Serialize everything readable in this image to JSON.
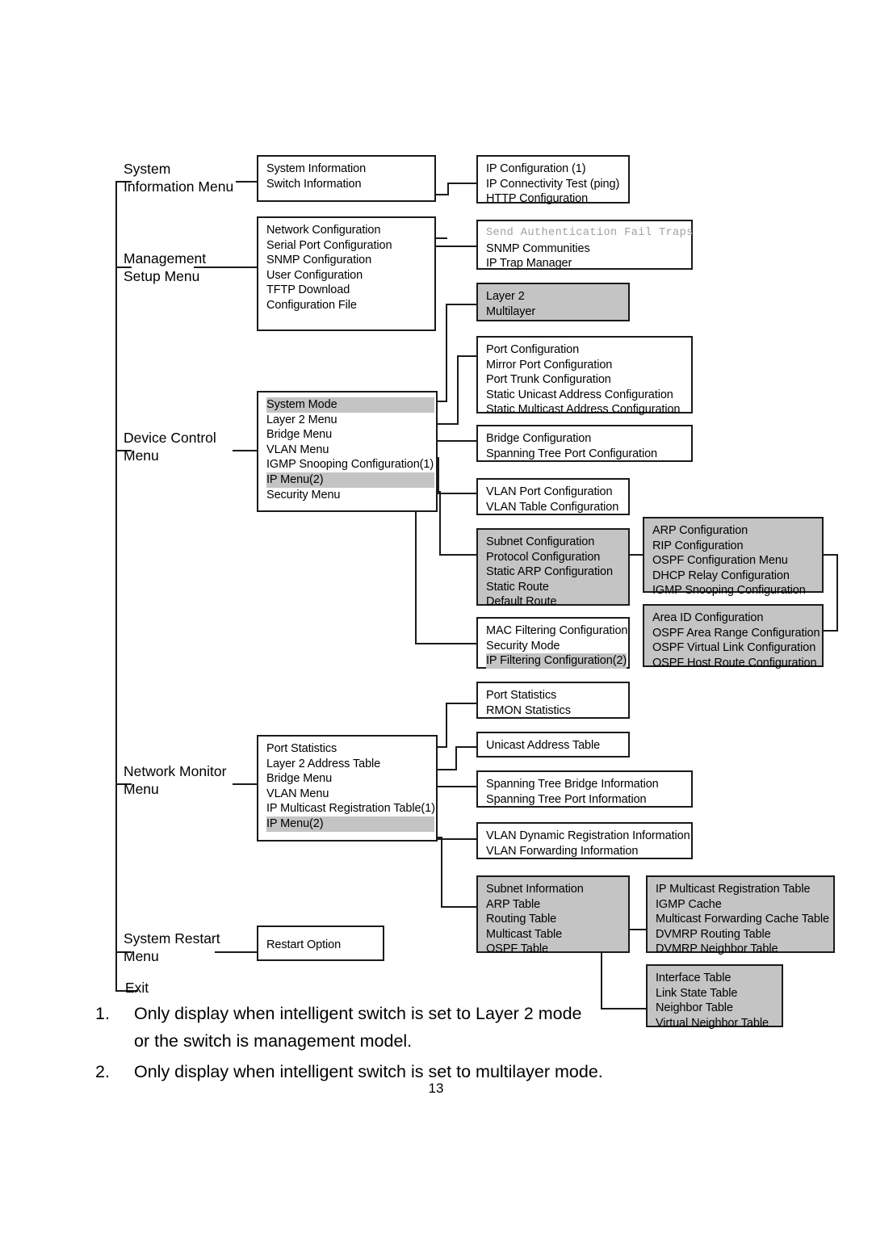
{
  "page": {
    "page_number": "13"
  },
  "diagram": {
    "type": "menu-tree",
    "trunk_labels": [
      {
        "id": "system-information-menu",
        "text": "System\nInformation Menu"
      },
      {
        "id": "management-setup-menu",
        "text": "Management\nSetup Menu"
      },
      {
        "id": "device-control-menu",
        "text": "Device Control\nMenu"
      },
      {
        "id": "network-monitor-menu",
        "text": "Network Monitor\nMenu"
      },
      {
        "id": "system-restart-menu",
        "text": "System Restart\nMenu"
      },
      {
        "id": "exit",
        "text": "Exit"
      }
    ],
    "boxes": [
      {
        "id": "system-information-box",
        "shaded": false,
        "rows": [
          {
            "text": "System Information",
            "highlight": false,
            "mono": false
          },
          {
            "text": "Switch Information",
            "highlight": false,
            "mono": false
          }
        ]
      },
      {
        "id": "ip-configuration-box",
        "shaded": false,
        "rows": [
          {
            "text": "IP Configuration (1)",
            "highlight": false,
            "mono": false
          },
          {
            "text": "IP Connectivity Test (ping)",
            "highlight": false,
            "mono": false
          },
          {
            "text": "HTTP Configuration",
            "highlight": false,
            "mono": false
          }
        ]
      },
      {
        "id": "management-setup-box",
        "shaded": false,
        "rows": [
          {
            "text": "Network Configuration",
            "highlight": false,
            "mono": false
          },
          {
            "text": "Serial Port Configuration",
            "highlight": false,
            "mono": false
          },
          {
            "text": "SNMP Configuration",
            "highlight": false,
            "mono": false
          },
          {
            "text": "User Configuration",
            "highlight": false,
            "mono": false
          },
          {
            "text": "TFTP Download",
            "highlight": false,
            "mono": false
          },
          {
            "text": "Configuration File",
            "highlight": false,
            "mono": false
          }
        ]
      },
      {
        "id": "snmp-box",
        "shaded": false,
        "rows": [
          {
            "text": "Send Authentication Fail Traps",
            "highlight": false,
            "mono": true
          },
          {
            "text": "SNMP Communities",
            "highlight": false,
            "mono": false
          },
          {
            "text": "IP Trap Manager",
            "highlight": false,
            "mono": false
          }
        ]
      },
      {
        "id": "system-mode-box",
        "shaded": true,
        "rows": [
          {
            "text": "Layer 2",
            "highlight": false,
            "mono": false
          },
          {
            "text": "Multilayer",
            "highlight": false,
            "mono": false
          }
        ]
      },
      {
        "id": "layer2-menu-box",
        "shaded": false,
        "rows": [
          {
            "text": "Port Configuration",
            "highlight": false,
            "mono": false
          },
          {
            "text": "Mirror Port Configuration",
            "highlight": false,
            "mono": false
          },
          {
            "text": "Port Trunk Configuration",
            "highlight": false,
            "mono": false
          },
          {
            "text": "Static Unicast Address Configuration",
            "highlight": false,
            "mono": false
          },
          {
            "text": "Static Multicast Address Configuration",
            "highlight": false,
            "mono": false
          }
        ]
      },
      {
        "id": "device-control-box",
        "shaded": false,
        "rows": [
          {
            "text": "System Mode",
            "highlight": true,
            "mono": false
          },
          {
            "text": "Layer 2 Menu",
            "highlight": false,
            "mono": false
          },
          {
            "text": "Bridge Menu",
            "highlight": false,
            "mono": false
          },
          {
            "text": "VLAN Menu",
            "highlight": false,
            "mono": false
          },
          {
            "text": "IGMP Snooping Configuration(1)",
            "highlight": false,
            "mono": false
          },
          {
            "text": "IP Menu(2)",
            "highlight": true,
            "mono": false
          },
          {
            "text": "Security Menu",
            "highlight": false,
            "mono": false
          }
        ]
      },
      {
        "id": "bridge-menu-box",
        "shaded": false,
        "rows": [
          {
            "text": "Bridge Configuration",
            "highlight": false,
            "mono": false
          },
          {
            "text": "Spanning Tree Port Configuration",
            "highlight": false,
            "mono": false
          }
        ]
      },
      {
        "id": "vlan-menu-box",
        "shaded": false,
        "rows": [
          {
            "text": "VLAN Port Configuration",
            "highlight": false,
            "mono": false
          },
          {
            "text": "VLAN Table Configuration",
            "highlight": false,
            "mono": false
          }
        ]
      },
      {
        "id": "ip-menu-box",
        "shaded": true,
        "rows": [
          {
            "text": "Subnet Configuration",
            "highlight": false,
            "mono": false
          },
          {
            "text": "Protocol Configuration",
            "highlight": false,
            "mono": false
          },
          {
            "text": "Static ARP Configuration",
            "highlight": false,
            "mono": false
          },
          {
            "text": "Static Route",
            "highlight": false,
            "mono": false
          },
          {
            "text": "Default Route",
            "highlight": false,
            "mono": false
          }
        ]
      },
      {
        "id": "protocol-configuration-box",
        "shaded": true,
        "rows": [
          {
            "text": "ARP Configuration",
            "highlight": false,
            "mono": false
          },
          {
            "text": "RIP Configuration",
            "highlight": false,
            "mono": false
          },
          {
            "text": "OSPF Configuration Menu",
            "highlight": false,
            "mono": false
          },
          {
            "text": "DHCP Relay Configuration",
            "highlight": false,
            "mono": false
          },
          {
            "text": "IGMP Snooping Configuration",
            "highlight": false,
            "mono": false
          }
        ]
      },
      {
        "id": "security-menu-box",
        "shaded": false,
        "rows": [
          {
            "text": "MAC Filtering Configuration",
            "highlight": false,
            "mono": false
          },
          {
            "text": "Security Mode",
            "highlight": false,
            "mono": false
          },
          {
            "text": "IP Filtering Configuration(2)",
            "highlight": true,
            "mono": false
          }
        ]
      },
      {
        "id": "ospf-configuration-box",
        "shaded": true,
        "rows": [
          {
            "text": "Area ID Configuration",
            "highlight": false,
            "mono": false
          },
          {
            "text": "OSPF Area Range Configuration",
            "highlight": false,
            "mono": false
          },
          {
            "text": "OSPF Virtual Link Configuration",
            "highlight": false,
            "mono": false
          },
          {
            "text": "OSPF Host Route Configuration",
            "highlight": false,
            "mono": false
          }
        ]
      },
      {
        "id": "port-statistics-box",
        "shaded": false,
        "rows": [
          {
            "text": "Port Statistics",
            "highlight": false,
            "mono": false
          },
          {
            "text": "RMON Statistics",
            "highlight": false,
            "mono": false
          }
        ]
      },
      {
        "id": "network-monitor-box",
        "shaded": false,
        "rows": [
          {
            "text": "Port Statistics",
            "highlight": false,
            "mono": false
          },
          {
            "text": "Layer 2 Address Table",
            "highlight": false,
            "mono": false
          },
          {
            "text": "Bridge Menu",
            "highlight": false,
            "mono": false
          },
          {
            "text": "VLAN Menu",
            "highlight": false,
            "mono": false
          },
          {
            "text": "IP Multicast Registration Table(1)",
            "highlight": false,
            "mono": false
          },
          {
            "text": "IP Menu(2)",
            "highlight": true,
            "mono": false
          }
        ]
      },
      {
        "id": "unicast-address-box",
        "shaded": false,
        "rows": [
          {
            "text": "Unicast Address Table",
            "highlight": false,
            "mono": false
          }
        ]
      },
      {
        "id": "spanning-tree-info-box",
        "shaded": false,
        "rows": [
          {
            "text": "Spanning Tree Bridge Information",
            "highlight": false,
            "mono": false
          },
          {
            "text": "Spanning Tree Port Information",
            "highlight": false,
            "mono": false
          }
        ]
      },
      {
        "id": "vlan-information-box",
        "shaded": false,
        "rows": [
          {
            "text": "VLAN Dynamic Registration Information",
            "highlight": false,
            "mono": false
          },
          {
            "text": "VLAN Forwarding Information",
            "highlight": false,
            "mono": false
          }
        ]
      },
      {
        "id": "subnet-information-box",
        "shaded": true,
        "rows": [
          {
            "text": "Subnet Information",
            "highlight": false,
            "mono": false
          },
          {
            "text": "ARP Table",
            "highlight": false,
            "mono": false
          },
          {
            "text": "Routing Table",
            "highlight": false,
            "mono": false
          },
          {
            "text": "Multicast Table",
            "highlight": false,
            "mono": false
          },
          {
            "text": "OSPF Table",
            "highlight": false,
            "mono": false
          }
        ]
      },
      {
        "id": "multicast-table-box",
        "shaded": true,
        "rows": [
          {
            "text": "IP Multicast Registration Table",
            "highlight": false,
            "mono": false
          },
          {
            "text": "IGMP Cache",
            "highlight": false,
            "mono": false
          },
          {
            "text": "Multicast Forwarding Cache Table",
            "highlight": false,
            "mono": false
          },
          {
            "text": "DVMRP Routing Table",
            "highlight": false,
            "mono": false
          },
          {
            "text": "DVMRP Neighbor Table",
            "highlight": false,
            "mono": false
          }
        ]
      },
      {
        "id": "ospf-table-box",
        "shaded": true,
        "rows": [
          {
            "text": "Interface Table",
            "highlight": false,
            "mono": false
          },
          {
            "text": "Link State Table",
            "highlight": false,
            "mono": false
          },
          {
            "text": "Neighbor Table",
            "highlight": false,
            "mono": false
          },
          {
            "text": "Virtual Neighbor Table",
            "highlight": false,
            "mono": false
          }
        ]
      },
      {
        "id": "restart-option-box",
        "shaded": false,
        "rows": [
          {
            "text": "Restart Option",
            "highlight": false,
            "mono": false
          }
        ]
      }
    ]
  },
  "footnotes": [
    {
      "num": "1.",
      "text": "Only display when intelligent switch is set to Layer 2 mode\nor the switch is management model."
    },
    {
      "num": "2.",
      "text": "Only display when intelligent switch is set to multilayer mode."
    }
  ],
  "colors": {
    "shade": "#c4c4c4",
    "line": "#1a1a1a",
    "mono_text": "#a0a0a0"
  }
}
